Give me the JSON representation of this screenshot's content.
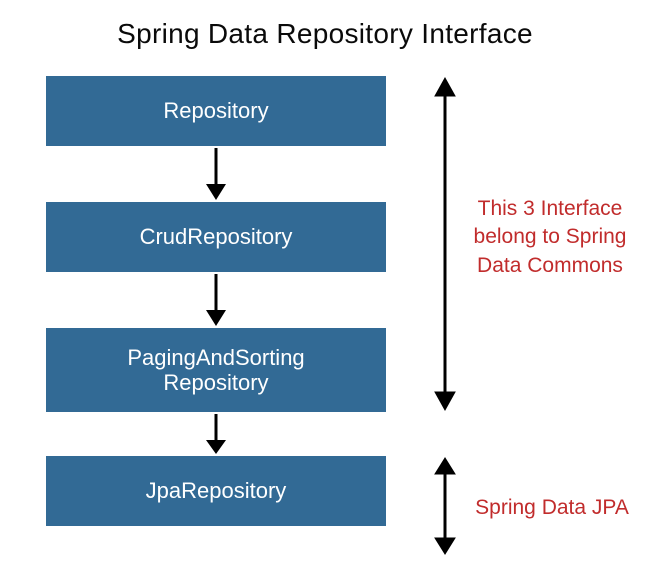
{
  "title": "Spring Data Repository Interface",
  "boxes": {
    "b1": "Repository",
    "b2": "CrudRepository",
    "b3_line1": "PagingAndSorting",
    "b3_line2": "Repository",
    "b4": "JpaRepository"
  },
  "labels": {
    "commons": "This 3 Interface belong to Spring Data Commons",
    "jpa": "Spring Data JPA"
  },
  "colors": {
    "box_bg": "#326a95",
    "label_red": "#c12c2c"
  }
}
